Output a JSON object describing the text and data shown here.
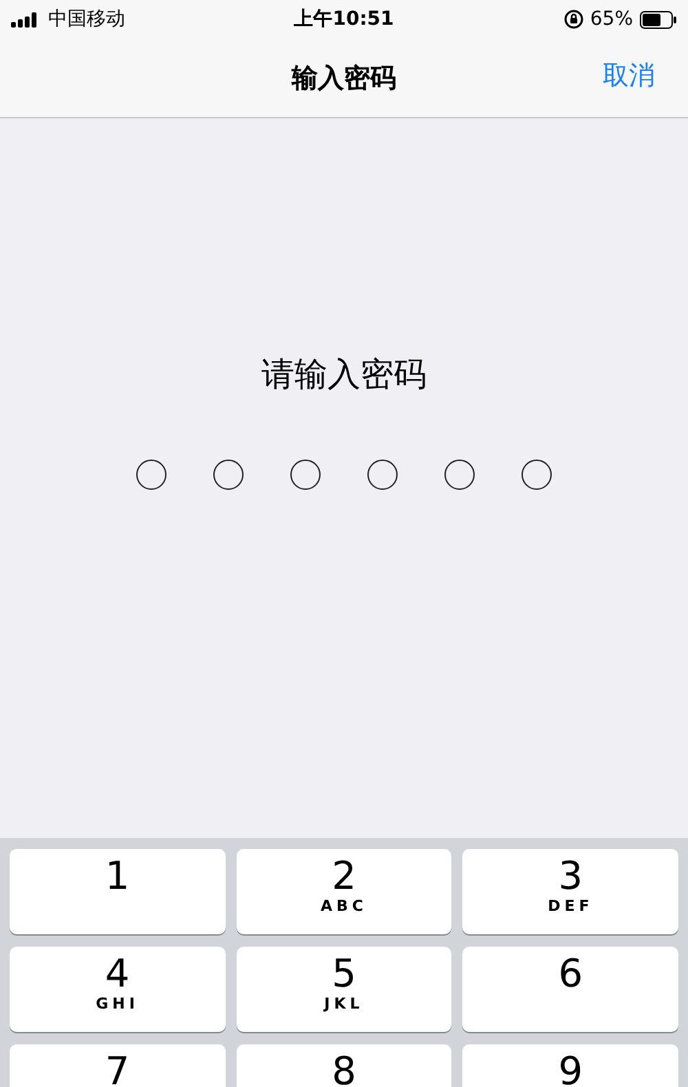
{
  "status_bar": {
    "carrier": "中国移动",
    "time": "上午10:51",
    "battery": "65%"
  },
  "nav": {
    "title": "输入密码",
    "cancel": "取消"
  },
  "prompt": "请输入密码",
  "passcode": [
    {
      "filled": false
    },
    {
      "filled": false
    },
    {
      "filled": false
    },
    {
      "filled": false
    },
    {
      "filled": false
    },
    {
      "filled": false
    }
  ],
  "keys": [
    {
      "digit": "1"
    },
    {
      "digit": "2",
      "letters": "ABC"
    },
    {
      "digit": "3",
      "letters": "DEF"
    },
    {
      "digit": "4",
      "letters": "GHI"
    },
    {
      "digit": "5",
      "letters": "JKL"
    },
    {
      "digit": "6"
    },
    {
      "digit": "7"
    },
    {
      "digit": "8"
    },
    {
      "digit": "9"
    }
  ]
}
